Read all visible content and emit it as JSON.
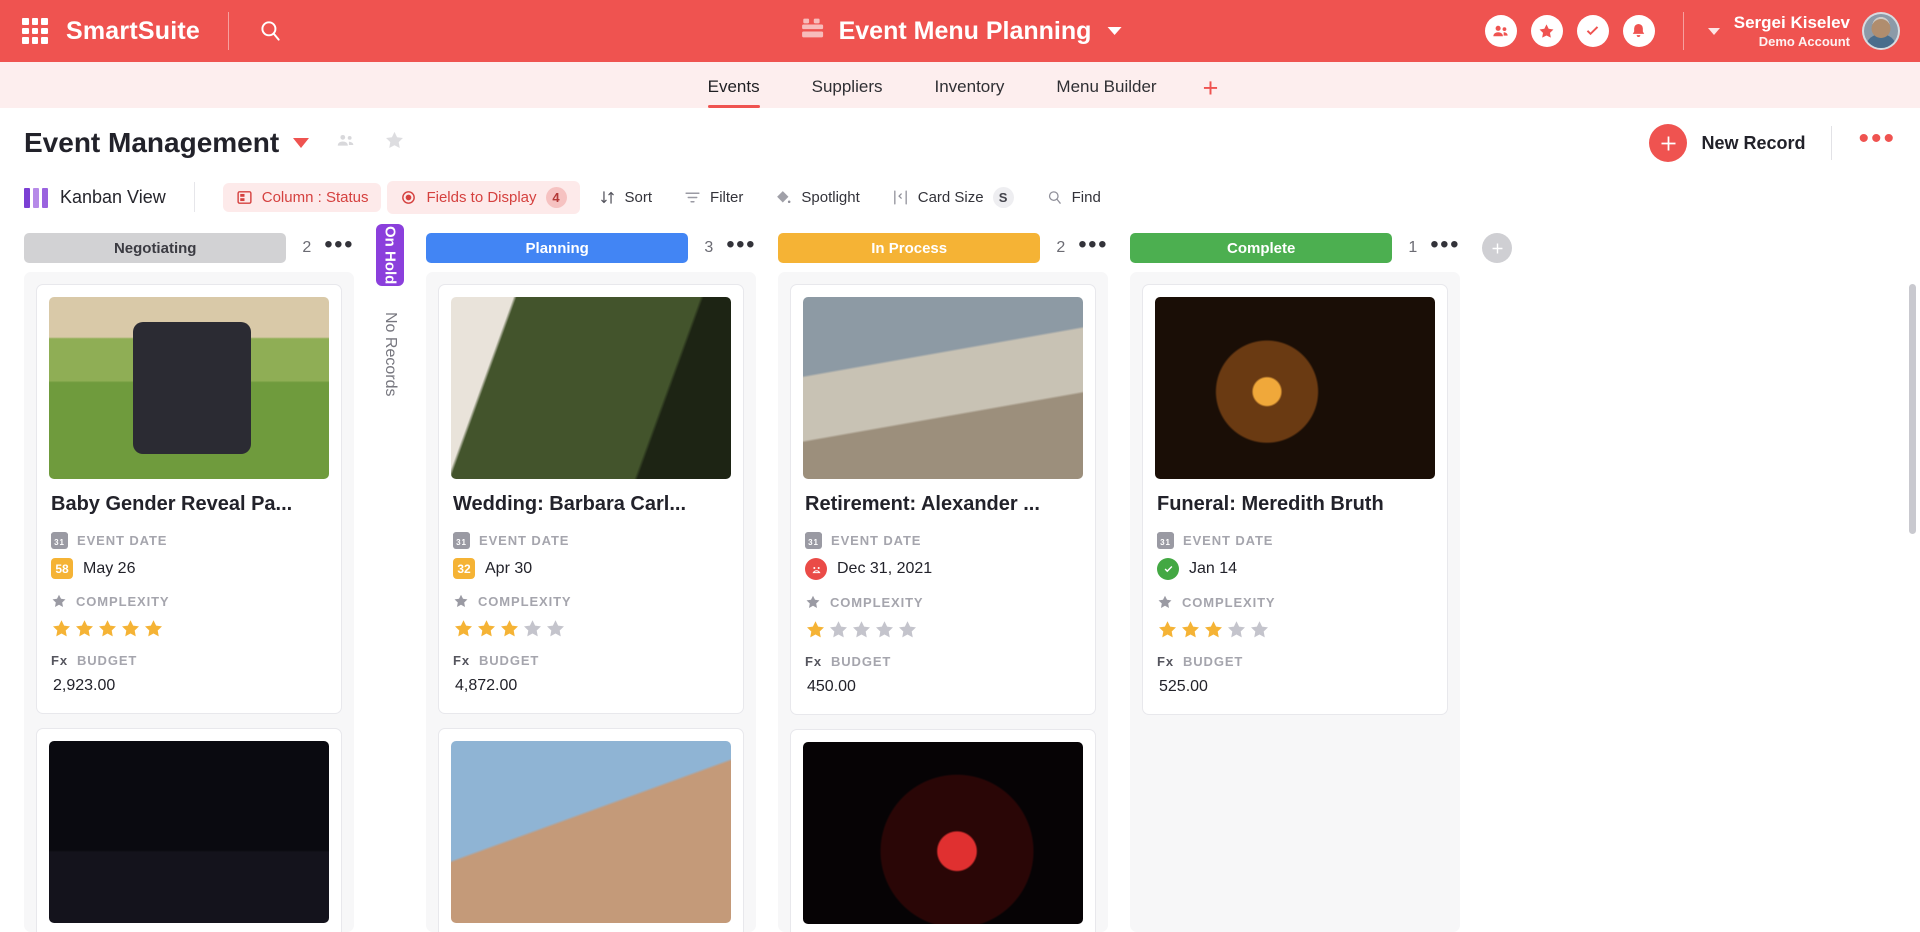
{
  "topbar": {
    "brand": "SmartSuite",
    "apps_icon": "apps-grid-icon",
    "search_icon": "search-icon",
    "center_title": "Event Menu Planning",
    "center_icon": "cake-icon",
    "actions": [
      {
        "name": "members-icon",
        "label": "Members"
      },
      {
        "name": "favorites-star-icon",
        "label": "Favorites"
      },
      {
        "name": "tasks-check-icon",
        "label": "Tasks"
      },
      {
        "name": "notifications-bell-icon",
        "label": "Notifications"
      }
    ],
    "user_name": "Sergei Kiselev",
    "user_account": "Demo Account"
  },
  "nav": {
    "tabs": [
      {
        "label": "Events",
        "active": true
      },
      {
        "label": "Suppliers",
        "active": false
      },
      {
        "label": "Inventory",
        "active": false
      },
      {
        "label": "Menu Builder",
        "active": false
      }
    ],
    "add_label": "+"
  },
  "title_row": {
    "title": "Event Management",
    "share_icon": "people-share-icon",
    "favorite_icon": "star-outline-icon",
    "new_record_label": "New Record",
    "more_label": "•••"
  },
  "toolbar": {
    "view_name": "Kanban View",
    "buttons": [
      {
        "name": "column-status",
        "label": "Column : Status",
        "icon": "columns-icon",
        "highlight": true,
        "badge": ""
      },
      {
        "name": "fields-to-display",
        "label": "Fields to Display",
        "icon": "eye-target-icon",
        "highlight": true,
        "badge": "4"
      },
      {
        "name": "sort",
        "label": "Sort",
        "icon": "sort-arrows-icon",
        "highlight": false,
        "badge": ""
      },
      {
        "name": "filter",
        "label": "Filter",
        "icon": "filter-lines-icon",
        "highlight": false,
        "badge": ""
      },
      {
        "name": "spotlight",
        "label": "Spotlight",
        "icon": "spotlight-diamond-icon",
        "highlight": false,
        "badge": ""
      },
      {
        "name": "card-size",
        "label": "Card Size",
        "icon": "resize-icon",
        "highlight": false,
        "badge": "S"
      },
      {
        "name": "find",
        "label": "Find",
        "icon": "search-icon",
        "highlight": false,
        "badge": ""
      }
    ]
  },
  "board": {
    "add_column_icon": "plus-icon",
    "columns": [
      {
        "name": "negotiating",
        "label": "Negotiating",
        "count": "2",
        "color": "#d2d2d4",
        "text_dark": true,
        "cards": [
          {
            "title": "Baby Gender Reveal Pa...",
            "photo": "ph-baby",
            "date_label": "EVENT DATE",
            "date_badge": "58",
            "date_badge_type": "number",
            "date_value": "May 26",
            "complexity_label": "COMPLEXITY",
            "complexity": 5,
            "budget_label": "BUDGET",
            "budget_value": "2,923.00"
          },
          {
            "title": "",
            "photo": "ph-dark",
            "partial": true
          }
        ]
      },
      {
        "name": "on-hold",
        "label": "On Hold",
        "count": "",
        "color": "#8b3fdc",
        "vertical": true,
        "empty_text": "No Records",
        "cards": []
      },
      {
        "name": "planning",
        "label": "Planning",
        "count": "3",
        "color": "#4285f4",
        "text_dark": false,
        "cards": [
          {
            "title": "Wedding: Barbara Carl...",
            "photo": "ph-wed",
            "date_label": "EVENT DATE",
            "date_badge": "32",
            "date_badge_type": "number",
            "date_value": "Apr 30",
            "complexity_label": "COMPLEXITY",
            "complexity": 3,
            "budget_label": "BUDGET",
            "budget_value": "4,872.00"
          },
          {
            "title": "",
            "photo": "ph-hands",
            "partial": true
          }
        ]
      },
      {
        "name": "in-process",
        "label": "In Process",
        "count": "2",
        "color": "#f5b335",
        "text_dark": false,
        "cards": [
          {
            "title": "Retirement: Alexander ...",
            "photo": "ph-chess",
            "date_label": "EVENT DATE",
            "date_badge": "sad",
            "date_badge_type": "sad",
            "date_value": "Dec 31, 2021",
            "complexity_label": "COMPLEXITY",
            "complexity": 1,
            "budget_label": "BUDGET",
            "budget_value": "450.00"
          },
          {
            "title": "",
            "photo": "ph-neon",
            "partial": true
          }
        ]
      },
      {
        "name": "complete",
        "label": "Complete",
        "count": "1",
        "color": "#4caf50",
        "text_dark": false,
        "cards": [
          {
            "title": "Funeral: Meredith Bruth",
            "photo": "ph-candle",
            "date_label": "EVENT DATE",
            "date_badge": "check",
            "date_badge_type": "check",
            "date_value": "Jan 14",
            "complexity_label": "COMPLEXITY",
            "complexity": 3,
            "budget_label": "BUDGET",
            "budget_value": "525.00"
          }
        ]
      }
    ]
  },
  "colors": {
    "brand": "#ef5350",
    "accent_star": "#f5b335",
    "star_empty": "#c4c4cc"
  }
}
